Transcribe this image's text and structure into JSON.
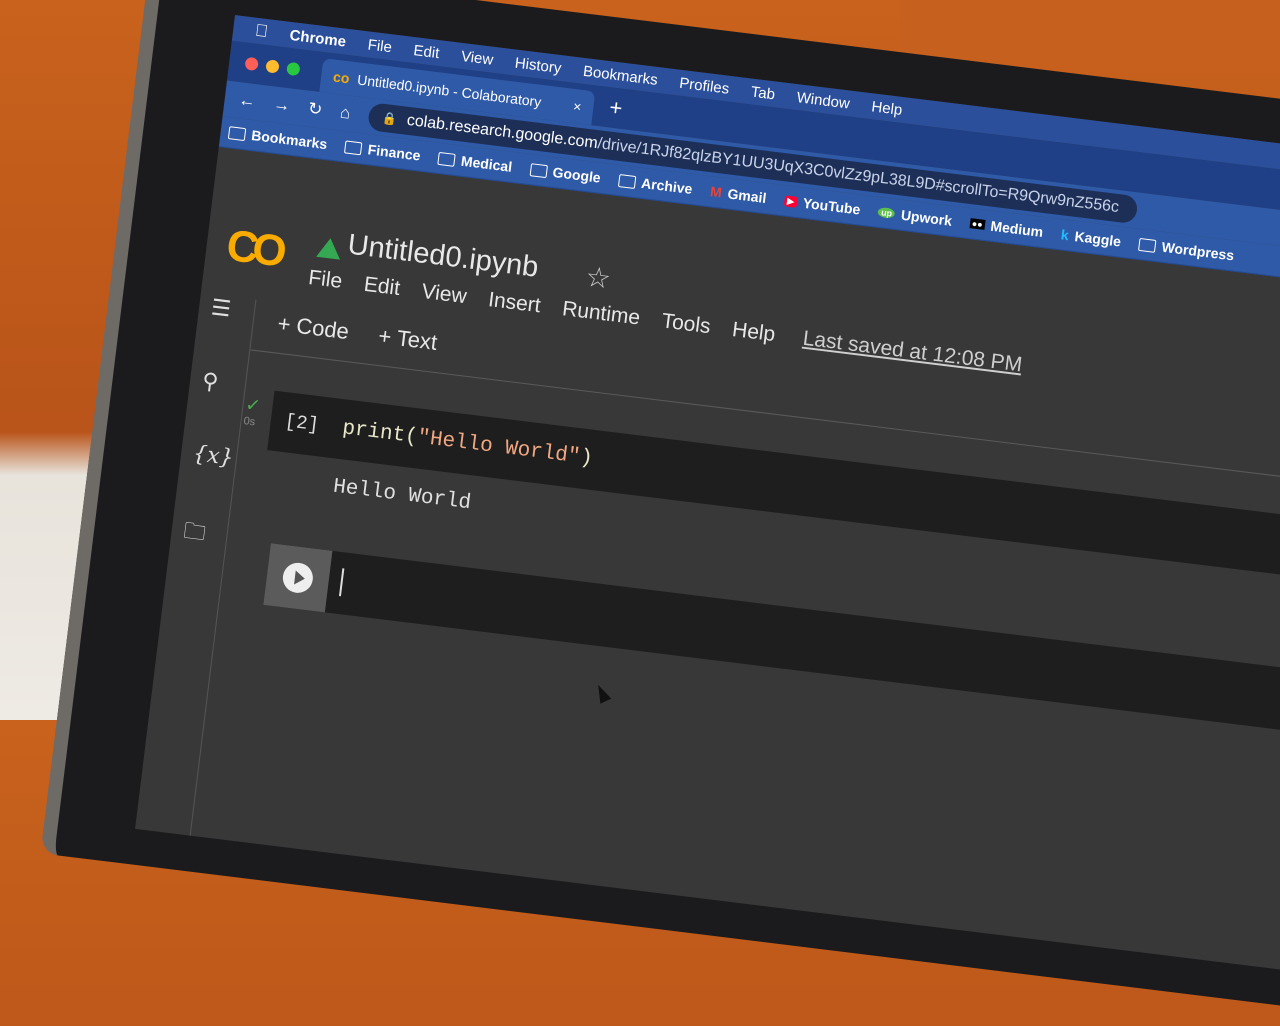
{
  "os_menu": {
    "apple_icon": "apple-icon",
    "items": [
      "Chrome",
      "File",
      "Edit",
      "View",
      "History",
      "Bookmarks",
      "Profiles",
      "Tab",
      "Window",
      "Help"
    ]
  },
  "tab": {
    "title": "Untitled0.ipynb - Colaboratory",
    "close": "×",
    "new_tab": "+"
  },
  "address": {
    "back": "←",
    "forward": "→",
    "reload": "↻",
    "home": "⌂",
    "lock": "🔒",
    "host": "colab.research.google.com",
    "path": "/drive/1RJf82qlzBY1UU3UqX3C0vlZz9pL38L9D#scrollTo=R9Qrw9nZ556c"
  },
  "bookmarks": [
    "Bookmarks",
    "Finance",
    "Medical",
    "Google",
    "Archive",
    "Gmail",
    "YouTube",
    "Upwork",
    "Medium",
    "Kaggle",
    "Wordpress"
  ],
  "colab": {
    "logo": "CO",
    "filename": "Untitled0.ipynb",
    "star": "☆",
    "menu": [
      "File",
      "Edit",
      "View",
      "Insert",
      "Runtime",
      "Tools",
      "Help"
    ],
    "last_saved": "Last saved at 12:08 PM",
    "toolbar": {
      "code": "+ Code",
      "text": "+ Text"
    },
    "sidebar": {
      "toc": "☰",
      "search": "⚲",
      "vars": "{x}",
      "files": "🗀"
    },
    "cell": {
      "status": "✓",
      "time": "0s",
      "exec_count": "[2]",
      "code_fn": "print(",
      "code_str": "\"Hello World\"",
      "code_end": ")",
      "output": "Hello World"
    }
  },
  "colors": {
    "chrome_blue": "#2f5aa8",
    "colab_bg": "#383838",
    "cell_bg": "#1e1e1e",
    "string": "#f0a782",
    "logo": "#f9ab00"
  }
}
